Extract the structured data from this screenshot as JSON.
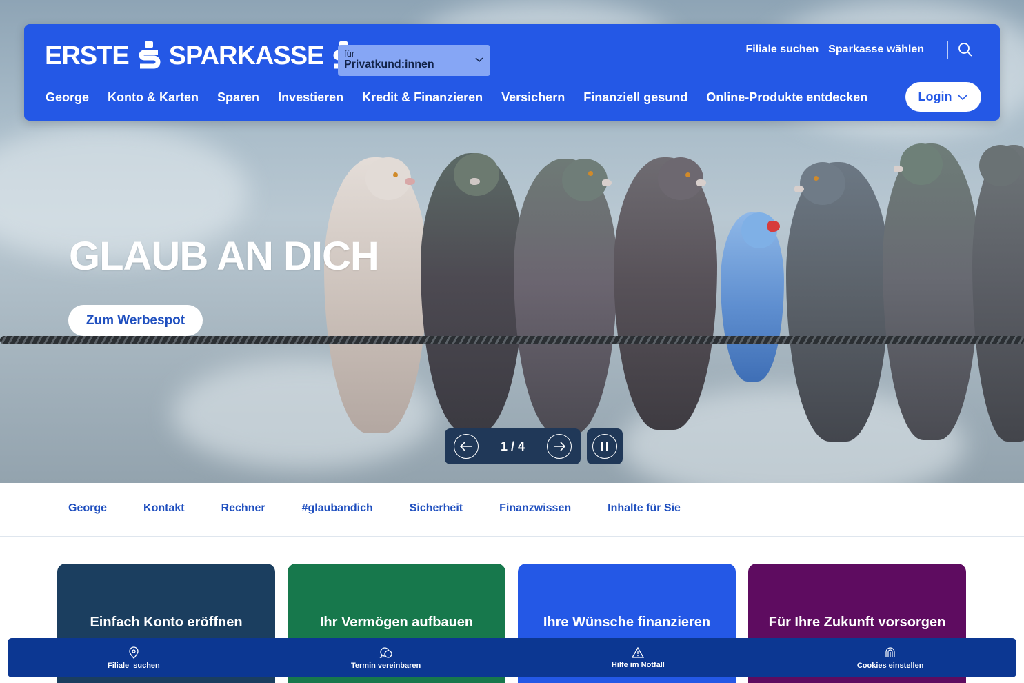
{
  "header": {
    "logo_left": "ERSTE",
    "logo_right": "SPARKASSE",
    "segment": {
      "prefix": "für",
      "value": "Privatkund:innen"
    },
    "top_links": [
      "Filiale suchen",
      "Sparkasse wählen"
    ],
    "nav": [
      "George",
      "Konto & Karten",
      "Sparen",
      "Investieren",
      "Kredit & Finanzieren",
      "Versichern",
      "Finanziell gesund",
      "Online-Produkte entdecken"
    ],
    "login_label": "Login"
  },
  "hero": {
    "title": "GLAUB AN DICH",
    "cta": "Zum Werbespot",
    "counter": "1 / 4"
  },
  "subnav": [
    "George",
    "Kontakt",
    "Rechner",
    "#glaubandich",
    "Sicherheit",
    "Finanzwissen",
    "Inhalte für Sie"
  ],
  "cards": [
    {
      "label": "Einfach Konto eröffnen",
      "color": "#1b3e5f"
    },
    {
      "label": "Ihr Vermögen aufbauen",
      "color": "#17784c"
    },
    {
      "label": "Ihre Wünsche finanzieren",
      "color": "#2458e6"
    },
    {
      "label": "Für Ihre Zukunft vorsorgen",
      "color": "#5e0c60"
    }
  ],
  "bottombar": [
    {
      "label": "Filiale  suchen",
      "icon": "location-pin-icon"
    },
    {
      "label": "Termin vereinbaren",
      "icon": "chat-icon"
    },
    {
      "label": "Hilfe im Notfall",
      "icon": "warning-icon"
    },
    {
      "label": "Cookies einstellen",
      "icon": "fingerprint-icon"
    }
  ],
  "colors": {
    "brand": "#2458e6",
    "bottombar": "#0c3792",
    "controls": "#203858"
  }
}
